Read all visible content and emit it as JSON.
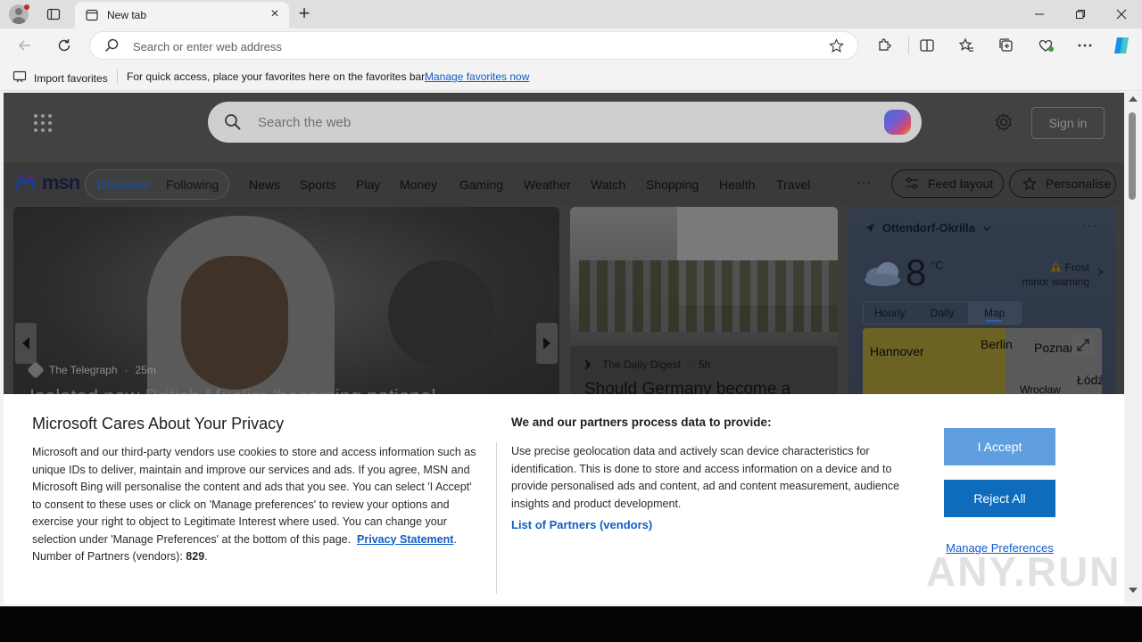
{
  "browser": {
    "tab_title": "New tab",
    "address_placeholder": "Search or enter web address"
  },
  "favorites_bar": {
    "import_label": "Import favorites",
    "message": "For quick access, place your favorites here on the favorites bar.",
    "manage_link": "Manage favorites now"
  },
  "msn": {
    "search_placeholder": "Search the web",
    "signin_label": "Sign in",
    "logo_text": "msn",
    "discover_label": "Discover",
    "following_label": "Following",
    "nav_items": [
      "News",
      "Sports",
      "Play",
      "Money",
      "Gaming",
      "Weather",
      "Watch",
      "Shopping",
      "Health",
      "Travel"
    ],
    "nav_more": "···",
    "feed_layout_label": "Feed layout",
    "personalise_label": "Personalise"
  },
  "hero_card": {
    "source": "The Telegraph",
    "time": "25m",
    "headline": "Isolated new British Muslim 'becoming national"
  },
  "second_card": {
    "source": "The Daily Digest",
    "time": "5h",
    "headline": "Should Germany become a"
  },
  "weather": {
    "location": "Ottendorf-Okrilla",
    "temperature": "8",
    "unit": "°C",
    "warning_title": "Frost",
    "warning_sub": "minor warning",
    "tabs": [
      "Hourly",
      "Daily",
      "Map"
    ],
    "active_tab": "Map",
    "map_labels": [
      "Hannover",
      "Berlin",
      "Poznan",
      "Wrocław",
      "Łódź"
    ],
    "more": "···"
  },
  "privacy": {
    "title": "Microsoft Cares About Your Privacy",
    "body": "Microsoft and our third-party vendors use cookies to store and access information such as unique IDs to deliver, maintain and improve our services and ads. If you agree, MSN and Microsoft Bing will personalise the content and ads that you see. You can select 'I Accept' to consent to these uses or click on 'Manage preferences' to review your options and exercise your right to object to Legitimate Interest where used.  You can change your selection under 'Manage Preferences' at the bottom of this page.",
    "privacy_link": "Privacy Statement",
    "partners_count_label": "Number of Partners (vendors):",
    "partners_count": "829",
    "right_title": "We and our partners process data to provide:",
    "right_body": "Use precise geolocation data and actively scan device characteristics for identification. This is done to store and access information on a device and to provide personalised ads and content, ad and content measurement, audience insights and product development.",
    "partners_link": "List of Partners (vendors)",
    "accept_label": "I Accept",
    "reject_label": "Reject All",
    "manage_label": "Manage Preferences"
  },
  "watermark": "ANY.RUN",
  "colors": {
    "accent": "#0f6cbd",
    "accept": "#5f9fe0",
    "link": "#0f5ec7"
  }
}
